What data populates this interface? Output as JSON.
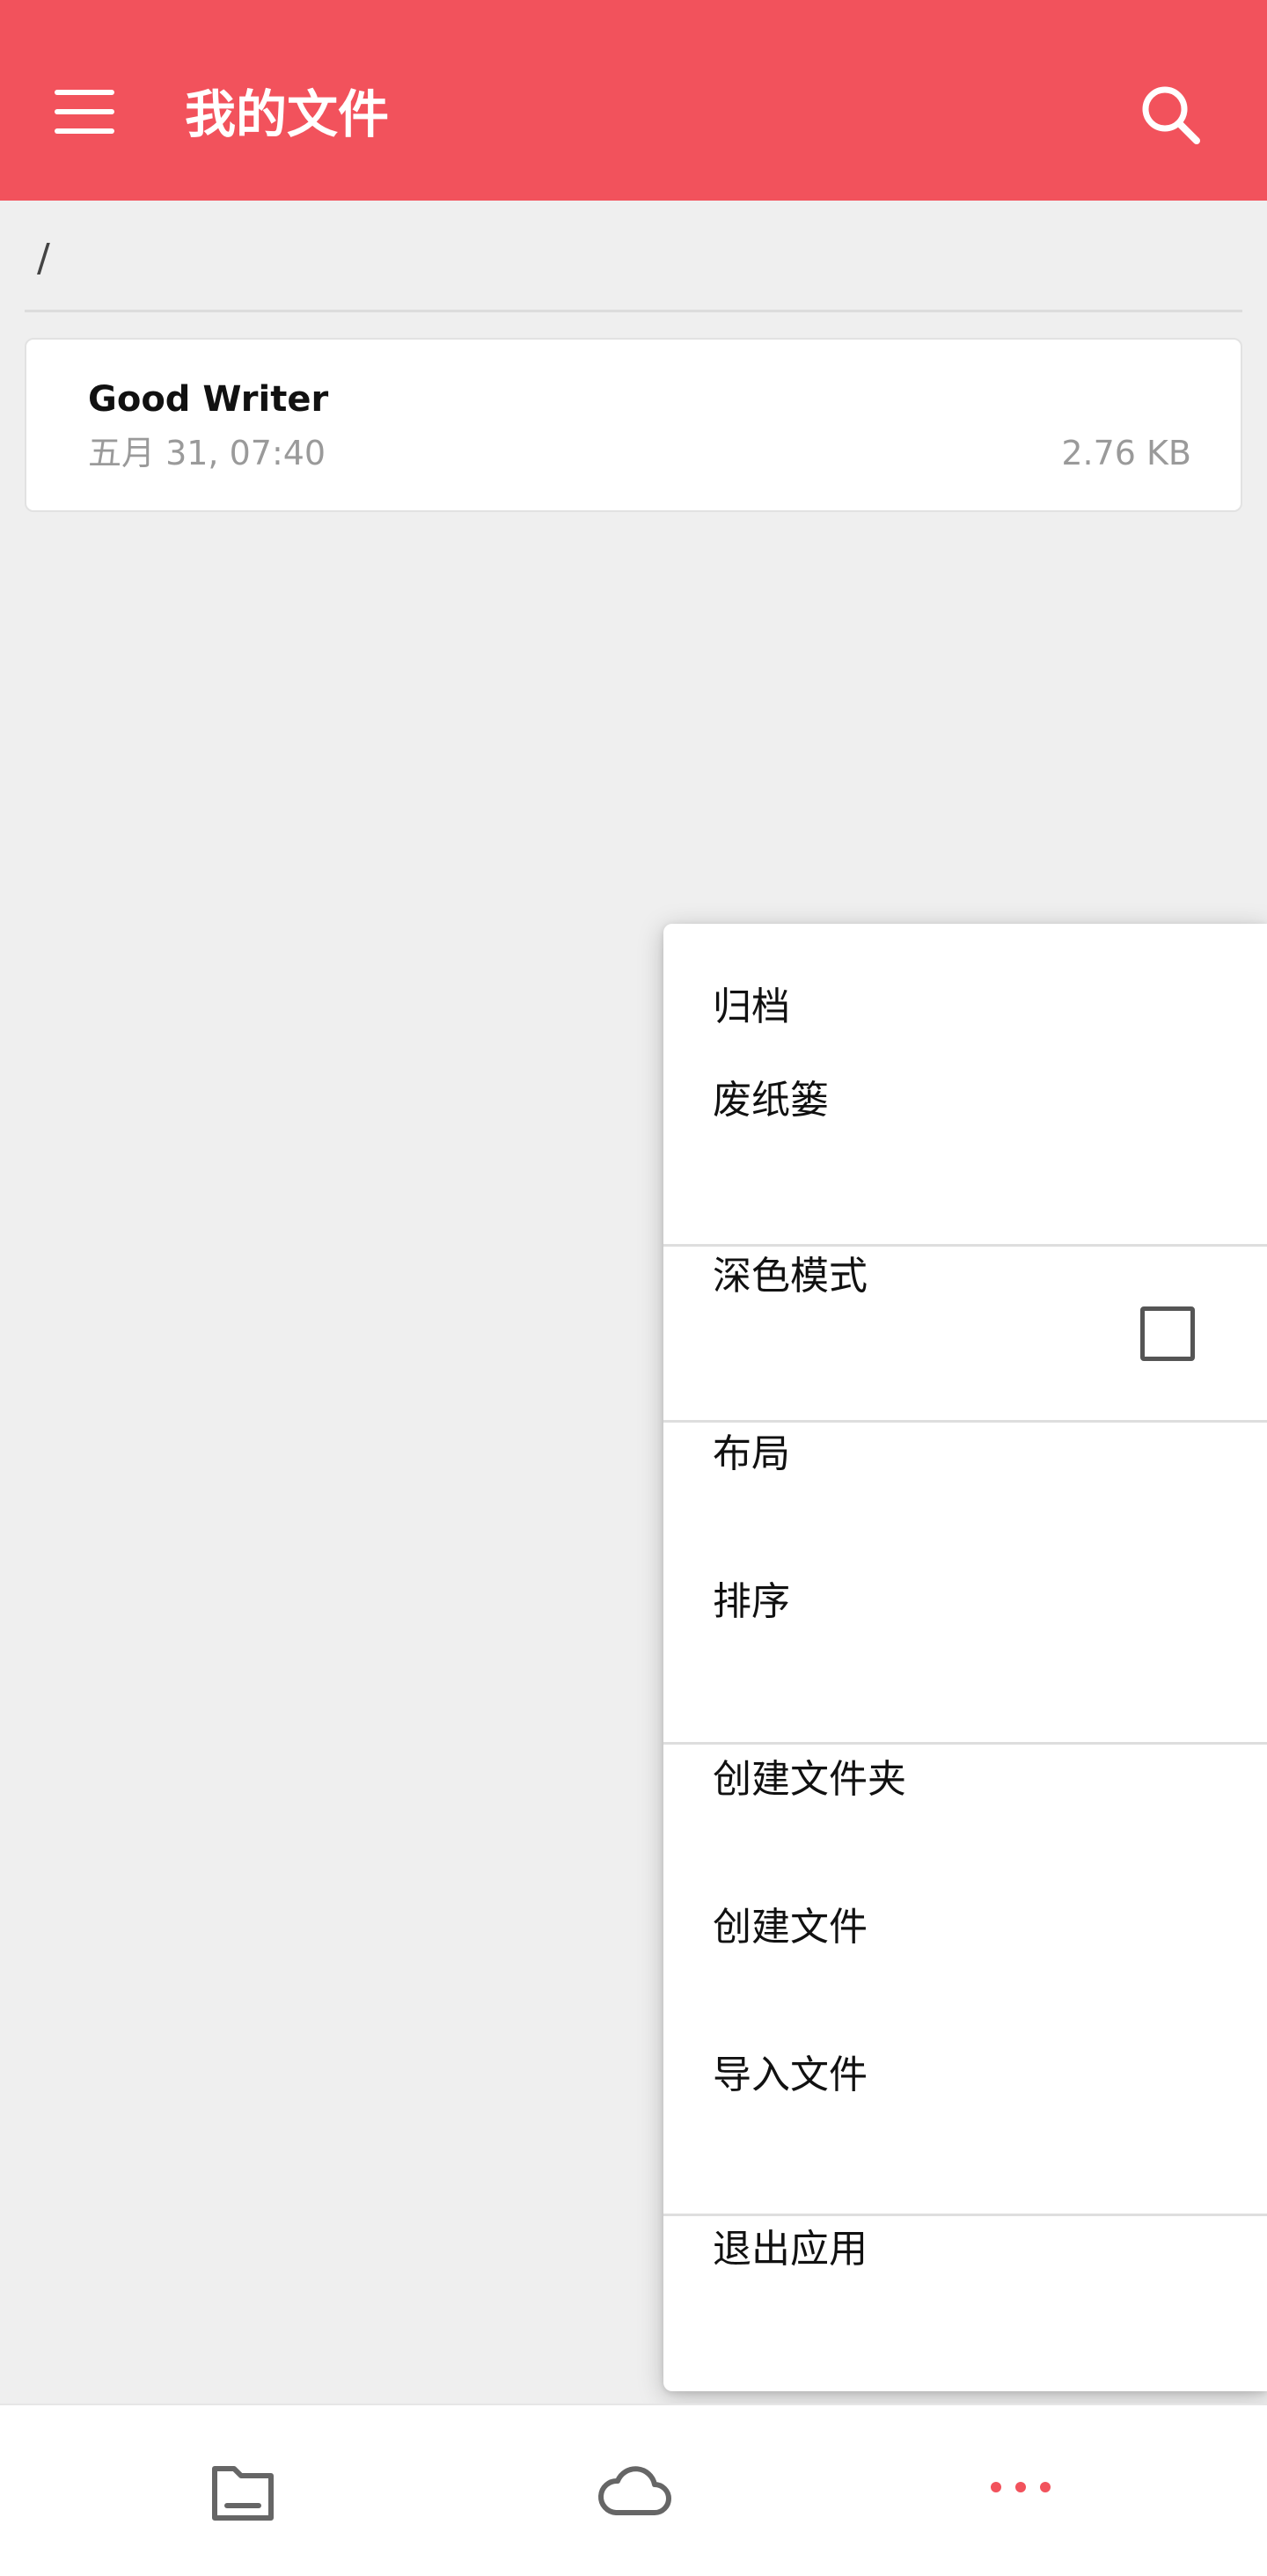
{
  "app_bar": {
    "title": "我的文件",
    "background_color": "#f2525c",
    "menu_icon": "hamburger-menu-icon",
    "search_icon": "search-icon"
  },
  "breadcrumb": {
    "path": "/"
  },
  "files": [
    {
      "name": "Good Writer",
      "date": "五月 31, 07:40",
      "size": "2.76 KB"
    }
  ],
  "menu": {
    "items": [
      {
        "label": "归档"
      },
      {
        "label": "废纸篓"
      },
      {
        "label": "深色模式",
        "checked": false
      },
      {
        "label": "布局"
      },
      {
        "label": "排序"
      },
      {
        "label": "创建文件夹"
      },
      {
        "label": "创建文件"
      },
      {
        "label": "导入文件"
      },
      {
        "label": "退出应用"
      }
    ]
  },
  "bottom_nav": {
    "items": [
      {
        "icon": "folder-icon"
      },
      {
        "icon": "cloud-icon"
      },
      {
        "icon": "more-dots-icon",
        "active_color": "#f2525c"
      }
    ]
  }
}
